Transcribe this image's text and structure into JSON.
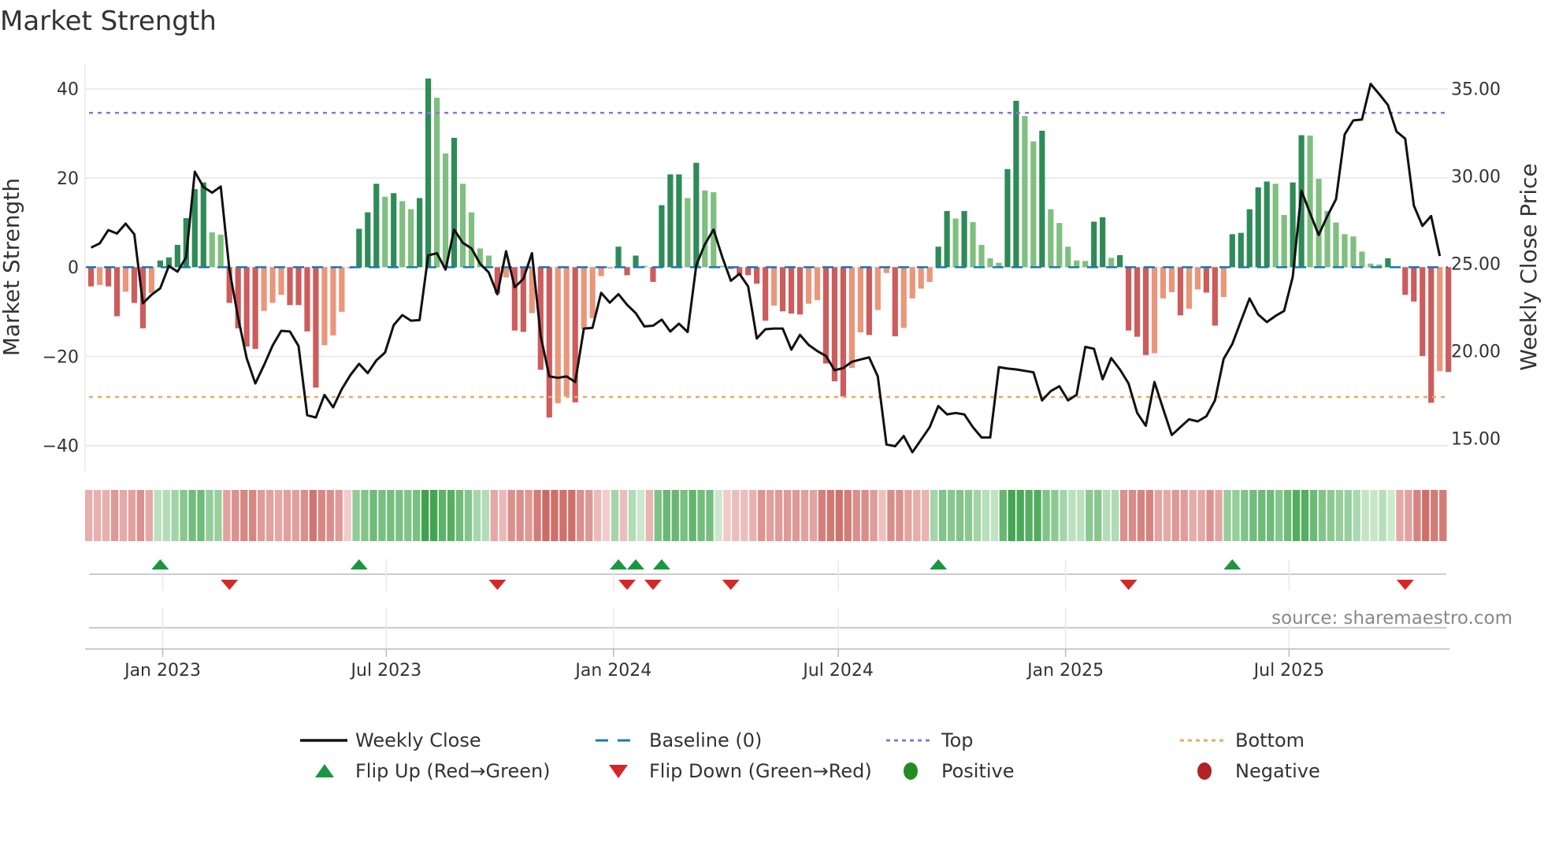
{
  "chart_data": {
    "type": "bar+line",
    "title": "Market Strength",
    "ylabel_left": "Market Strength",
    "ylabel_right": "Weekly Close Price",
    "ylim_left": [
      -45.7,
      45.6
    ],
    "ylim_right": [
      13.13,
      36.42
    ],
    "yticks_left": [
      {
        "v": 40,
        "label": "40"
      },
      {
        "v": 20,
        "label": "20"
      },
      {
        "v": 0,
        "label": "0"
      },
      {
        "v": -20,
        "label": "−20"
      },
      {
        "v": -40,
        "label": "−40"
      }
    ],
    "yticks_right": [
      {
        "v": 35,
        "label": "35.00"
      },
      {
        "v": 30,
        "label": "30.00"
      },
      {
        "v": 25,
        "label": "25.00"
      },
      {
        "v": 20,
        "label": "20.00"
      },
      {
        "v": 15,
        "label": "15.00"
      }
    ],
    "x_ticks": [
      {
        "date": "2023-01-01",
        "label": "Jan 2023"
      },
      {
        "date": "2023-07-01",
        "label": "Jul 2023"
      },
      {
        "date": "2024-01-01",
        "label": "Jan 2024"
      },
      {
        "date": "2024-07-01",
        "label": "Jul 2024"
      },
      {
        "date": "2025-01-01",
        "label": "Jan 2025"
      },
      {
        "date": "2025-07-01",
        "label": "Jul 2025"
      }
    ],
    "start_date": "2022-11-04",
    "frequency": "weekly",
    "top": 34.6,
    "bottom": -29.1,
    "baseline": 0,
    "strength": [
      -4.3,
      -4,
      -4.3,
      -11,
      -5.5,
      -8,
      -13.7,
      -5.8,
      1.5,
      2.2,
      5,
      11,
      17.5,
      19,
      7.8,
      7.3,
      -8,
      -13.7,
      -17.8,
      -18.3,
      -9.8,
      -8,
      -6.2,
      -8.5,
      -8.5,
      -14.4,
      -27,
      -17.5,
      -15.3,
      -10,
      -0.3,
      8.6,
      12.3,
      18.7,
      15.8,
      16.6,
      14.8,
      13,
      15.5,
      42.3,
      38,
      25.5,
      29,
      18.7,
      12.3,
      4.2,
      2.6,
      -5.9,
      -2.3,
      -14.2,
      -14.5,
      -10.3,
      -23,
      -33.7,
      -30.5,
      -29,
      -30.3,
      -13.9,
      -11.4,
      -2,
      -0.3,
      4.6,
      -1.8,
      2.6,
      0.3,
      -3.3,
      13.9,
      20.8,
      20.8,
      15.5,
      23.4,
      17.2,
      16.8,
      0.3,
      -0.4,
      -1.8,
      -1.8,
      -3.7,
      -12,
      -8.6,
      -9.9,
      -10.4,
      -10.6,
      -8.2,
      -7.4,
      -21.6,
      -25.6,
      -29,
      -22.6,
      -14.6,
      -15.2,
      -9.6,
      -1.3,
      -15.5,
      -13.6,
      -7,
      -4.8,
      -3.3,
      4.6,
      12.6,
      10.9,
      12.6,
      10.1,
      5,
      2,
      1,
      22,
      37.3,
      33.9,
      28.2,
      30.6,
      13,
      9.9,
      4.6,
      1.5,
      1.4,
      10.2,
      11.2,
      2.1,
      2.7,
      -14.2,
      -15.6,
      -19.7,
      -19.3,
      -7,
      -5.6,
      -10.8,
      -9.3,
      -5,
      -5.7,
      -13.1,
      -6.7,
      7.4,
      7.7,
      13,
      17.9,
      19.2,
      18.7,
      11.7,
      19,
      29.6,
      29.5,
      19.8,
      12.6,
      10,
      7.4,
      6.9,
      3.5,
      0.8,
      0.6,
      2,
      0.2,
      -6.2,
      -7.7,
      -19.9,
      -30.4,
      -23.3,
      -23.5
    ],
    "close": [
      25.91,
      26.15,
      26.91,
      26.71,
      27.28,
      26.67,
      22.72,
      23.21,
      23.58,
      24.86,
      24.53,
      25.35,
      30.25,
      29.37,
      29.05,
      29.4,
      24.65,
      21.92,
      19.59,
      18.14,
      19.18,
      20.31,
      21.15,
      21.11,
      20.28,
      16.32,
      16.19,
      17.48,
      16.77,
      17.82,
      18.62,
      19.26,
      18.73,
      19.46,
      19.91,
      21.47,
      22.05,
      21.73,
      21.76,
      25.46,
      25.59,
      24.65,
      26.94,
      26.18,
      25.86,
      24.98,
      24.49,
      23.24,
      25.7,
      23.64,
      24.12,
      25.59,
      20.87,
      18.54,
      18.46,
      18.54,
      18.22,
      21.28,
      21.32,
      23.32,
      22.76,
      23.25,
      22.64,
      22.16,
      21.4,
      21.44,
      21.79,
      21.11,
      21.56,
      21.08,
      24.9,
      26.1,
      26.94,
      25.38,
      24.01,
      24.41,
      23.69,
      20.71,
      21.24,
      21.28,
      21.28,
      20.07,
      20.92,
      20.34,
      19.99,
      19.71,
      18.89,
      19.02,
      19.38,
      19.51,
      19.63,
      18.54,
      14.65,
      14.55,
      15.13,
      14.2,
      14.92,
      15.64,
      16.85,
      16.37,
      16.45,
      16.37,
      15.64,
      15.05,
      15.05,
      19.07,
      18.99,
      18.94,
      18.86,
      18.78,
      17.17,
      17.7,
      17.98,
      17.17,
      17.49,
      20.23,
      20.12,
      18.38,
      19.59,
      18.94,
      18.14,
      16.45,
      15.72,
      18.22,
      16.69,
      15.19,
      15.64,
      16.09,
      15.97,
      16.26,
      17.17,
      19.54,
      20.39,
      21.71,
      23.0,
      22.08,
      21.65,
      22.0,
      22.29,
      24.25,
      29.16,
      27.87,
      26.63,
      27.71,
      28.68,
      32.38,
      33.18,
      33.23,
      35.27,
      34.68,
      34.07,
      32.54,
      32.14,
      28.31,
      27.15,
      27.71,
      25.43
    ],
    "colors": {
      "pos_strong": "#2e8b57",
      "pos_weak": "#7fbf7f",
      "neg_strong": "#cd5c5c",
      "neg_weak": "#e9967a",
      "close": "#111111",
      "baseline": "#1f77b4",
      "top": "#9370db",
      "bottom": "#f4a460",
      "flip_up": "#1a9641",
      "flip_down": "#d62728",
      "positive": "#228b22",
      "negative": "#b22222"
    },
    "legend": [
      {
        "key": "close",
        "label": "Weekly Close",
        "symbol": "line"
      },
      {
        "key": "baseline",
        "label": "Baseline (0)",
        "symbol": "dash"
      },
      {
        "key": "top",
        "label": "Top",
        "symbol": "dot"
      },
      {
        "key": "bottom",
        "label": "Bottom",
        "symbol": "dot"
      },
      {
        "key": "flip_up",
        "label": "Flip Up (Red→Green)",
        "symbol": "up"
      },
      {
        "key": "flip_down",
        "label": "Flip Down (Green→Red)",
        "symbol": "down"
      },
      {
        "key": "positive",
        "label": "Positive",
        "symbol": "circle"
      },
      {
        "key": "negative",
        "label": "Negative",
        "symbol": "circle"
      }
    ],
    "legend_position": "bottom",
    "source": "source: sharemaestro.com"
  }
}
